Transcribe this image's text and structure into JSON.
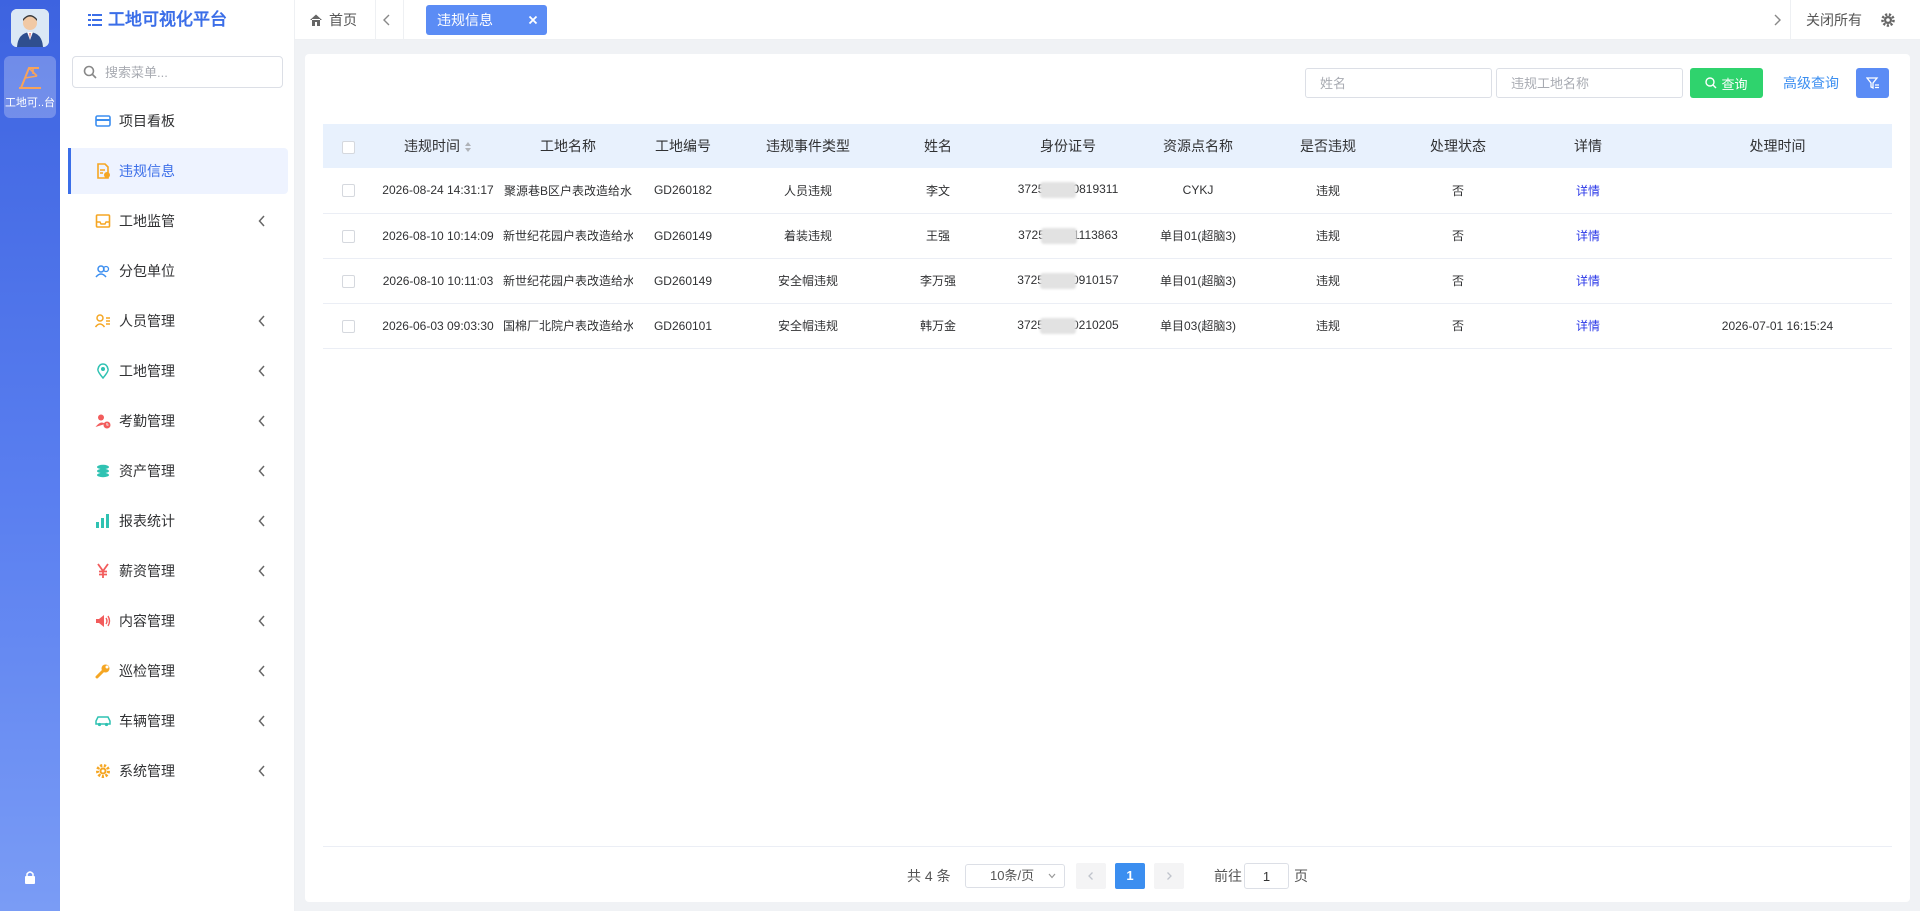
{
  "rail": {
    "app_label": "工地可..台"
  },
  "sidebar": {
    "brand_title": "工地可视化平台",
    "search_placeholder": "搜索菜单...",
    "items": [
      {
        "label": "项目看板",
        "icon": "card-icon",
        "color": "#3b8ef0",
        "expandable": false
      },
      {
        "label": "违规信息",
        "icon": "document-warning-icon",
        "color": "#f5a623",
        "expandable": false,
        "active": true
      },
      {
        "label": "工地监管",
        "icon": "inbox-icon",
        "color": "#f5a623",
        "expandable": true
      },
      {
        "label": "分包单位",
        "icon": "users-icon",
        "color": "#3b8ef0",
        "expandable": false
      },
      {
        "label": "人员管理",
        "icon": "user-list-icon",
        "color": "#f5a623",
        "expandable": true
      },
      {
        "label": "工地管理",
        "icon": "location-icon",
        "color": "#2fc2b2",
        "expandable": true
      },
      {
        "label": "考勤管理",
        "icon": "user-clock-icon",
        "color": "#f25c5c",
        "expandable": true
      },
      {
        "label": "资产管理",
        "icon": "coins-icon",
        "color": "#2fc2b2",
        "expandable": true
      },
      {
        "label": "报表统计",
        "icon": "bar-chart-icon",
        "color": "#2fc2b2",
        "expandable": true
      },
      {
        "label": "薪资管理",
        "icon": "yen-icon",
        "color": "#f25c5c",
        "expandable": true
      },
      {
        "label": "内容管理",
        "icon": "speaker-icon",
        "color": "#f25c5c",
        "expandable": true
      },
      {
        "label": "巡检管理",
        "icon": "wrench-icon",
        "color": "#f5a623",
        "expandable": true
      },
      {
        "label": "车辆管理",
        "icon": "car-icon",
        "color": "#2fc2b2",
        "expandable": true
      },
      {
        "label": "系统管理",
        "icon": "gear-icon",
        "color": "#f5a623",
        "expandable": true
      }
    ]
  },
  "tabs": {
    "home_label": "首页",
    "active_label": "违规信息",
    "close_all_label": "关闭所有"
  },
  "filters": {
    "name_placeholder": "姓名",
    "site_placeholder": "违规工地名称",
    "query_label": "查询",
    "advanced_label": "高级查询"
  },
  "table": {
    "headers": [
      "违规时间",
      "工地名称",
      "工地编号",
      "违规事件类型",
      "姓名",
      "身份证号",
      "资源点名称",
      "是否违规",
      "处理状态",
      "详情",
      "处理时间"
    ],
    "rows": [
      {
        "time": "2026-08-24 14:31:17",
        "site": "聚源巷B区户表改造给水",
        "code": "GD260182",
        "type": "人员违规",
        "name": "李文",
        "id_start": "3725",
        "id_end": "0819311",
        "resource": "CYKJ",
        "violation": "违规",
        "status": "否",
        "detail": "详情",
        "handled_time": ""
      },
      {
        "time": "2026-08-10 10:14:09",
        "site": "新世纪花园户表改造给水",
        "code": "GD260149",
        "type": "着装违规",
        "name": "王强",
        "id_start": "3725",
        "id_end": "1113863",
        "resource": "单目01(超脑3)",
        "violation": "违规",
        "status": "否",
        "detail": "详情",
        "handled_time": ""
      },
      {
        "time": "2026-08-10 10:11:03",
        "site": "新世纪花园户表改造给水",
        "code": "GD260149",
        "type": "安全帽违规",
        "name": "李万强",
        "id_start": "3725",
        "id_end": "0910157",
        "resource": "单目01(超脑3)",
        "violation": "违规",
        "status": "否",
        "detail": "详情",
        "handled_time": ""
      },
      {
        "time": "2026-06-03 09:03:30",
        "site": "国棉厂北院户表改造给水",
        "code": "GD260101",
        "type": "安全帽违规",
        "name": "韩万金",
        "id_start": "3725",
        "id_end": "0210205",
        "resource": "单目03(超脑3)",
        "violation": "违规",
        "status": "否",
        "detail": "详情",
        "handled_time": "2026-07-01 16:15:24"
      }
    ]
  },
  "pager": {
    "total_label": "共 4 条",
    "page_size_label": "10条/页",
    "current_page": "1",
    "goto_label": "前往",
    "goto_value": "1",
    "page_suffix": "页"
  },
  "colors": {
    "primary": "#3b6ee8",
    "active_tab": "#5b8cf5",
    "query_button": "#2fd36d",
    "header_bg": "#e8f1fd",
    "link": "#2b38e8"
  }
}
